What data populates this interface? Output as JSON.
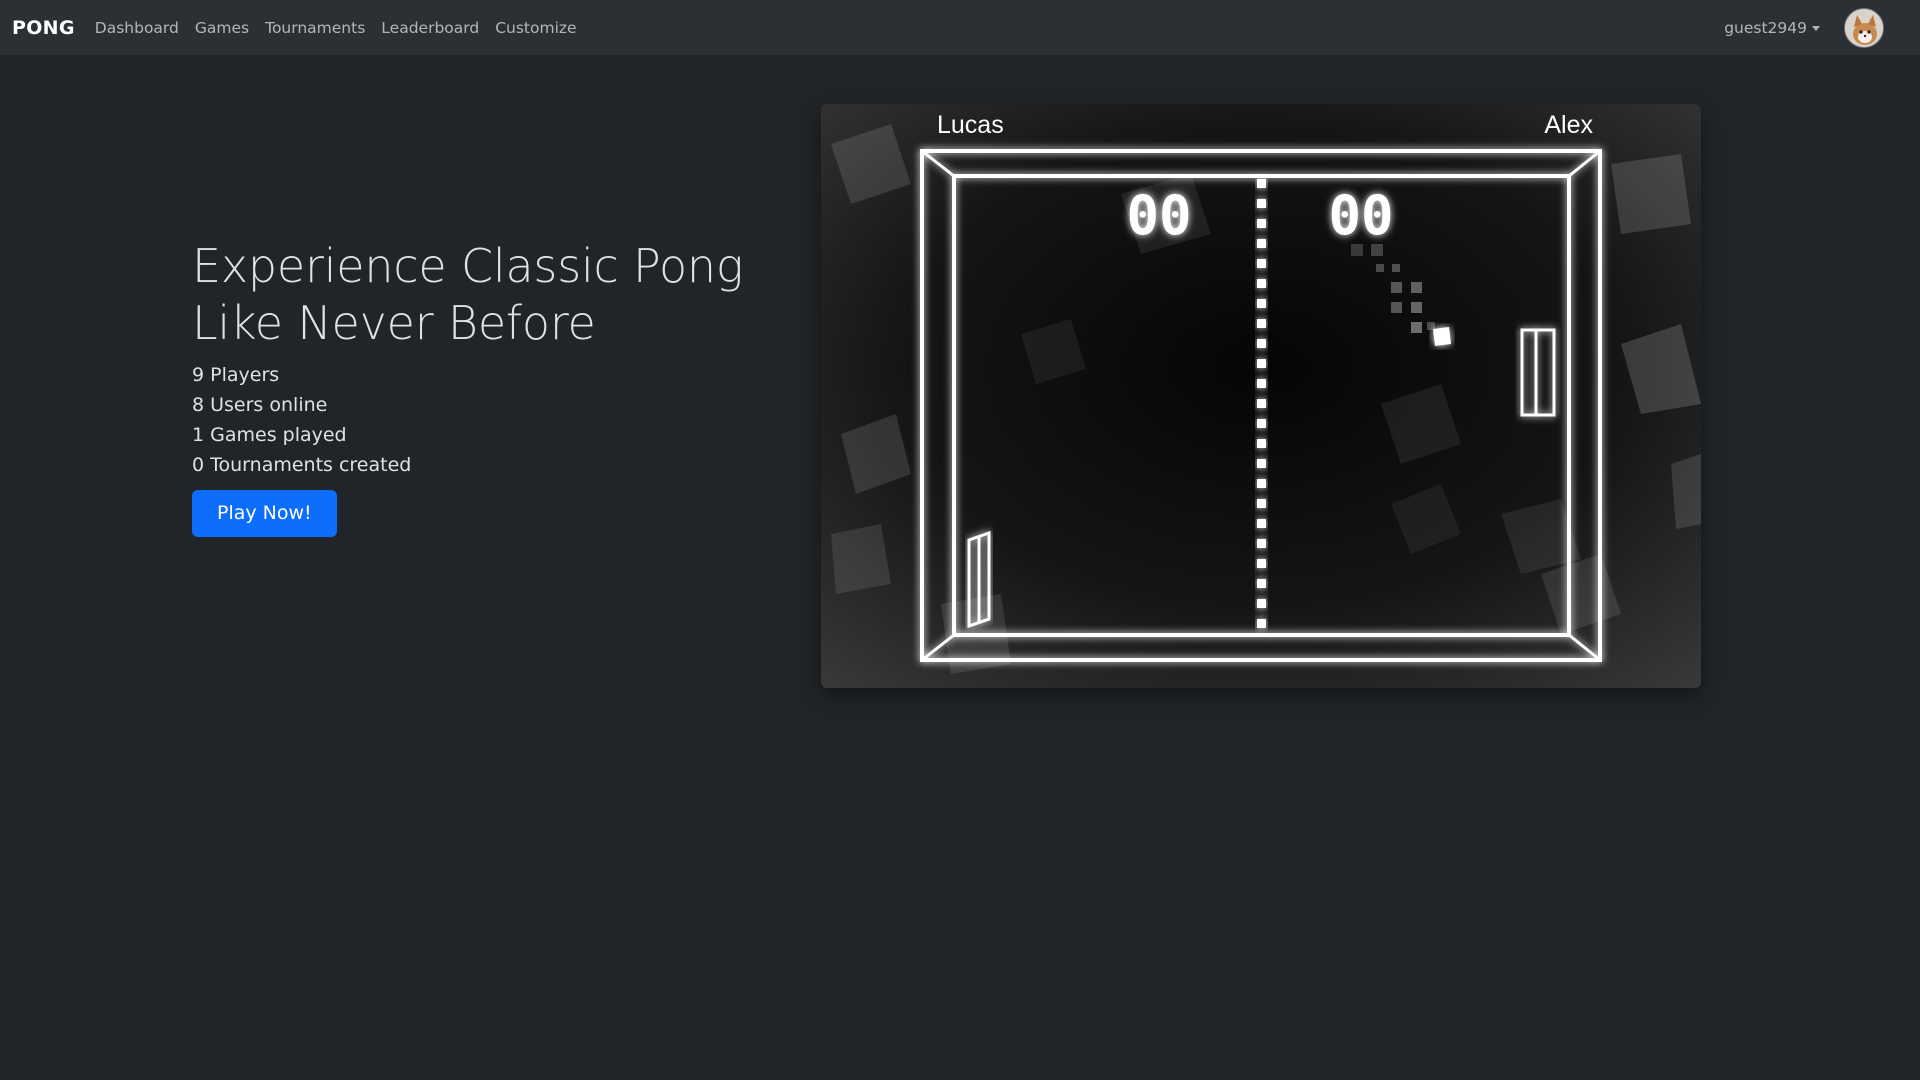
{
  "navbar": {
    "brand": "PONG",
    "links": [
      "Dashboard",
      "Games",
      "Tournaments",
      "Leaderboard",
      "Customize"
    ],
    "username": "guest2949"
  },
  "hero": {
    "title": "Experience Classic Pong Like Never Before",
    "stats": [
      "9 Players",
      "8 Users online",
      "1 Games played",
      "0 Tournaments created"
    ],
    "cta_label": "Play Now!"
  },
  "game_preview": {
    "player_left": "Lucas",
    "player_right": "Alex",
    "score_left": "00",
    "score_right": "00"
  }
}
